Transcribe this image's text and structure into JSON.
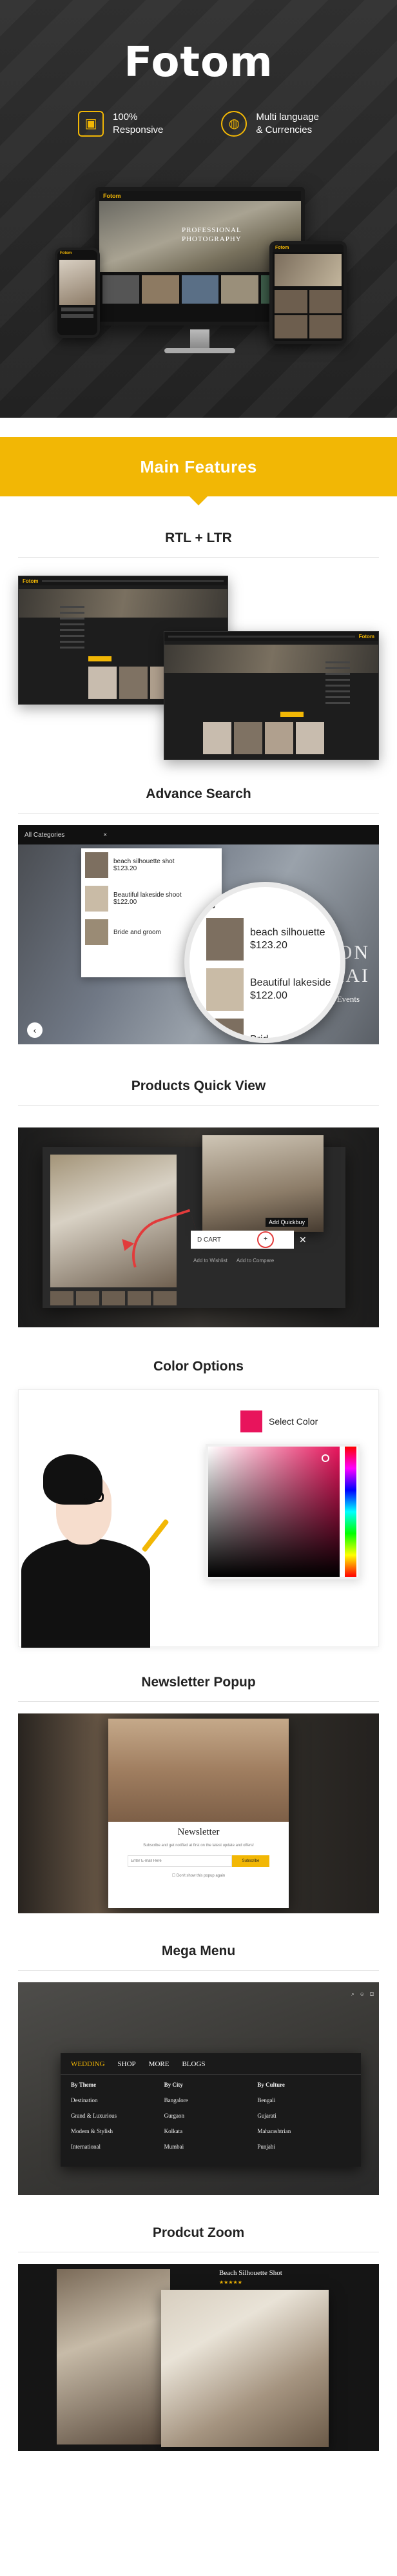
{
  "hero": {
    "logo": "Fotom",
    "features": [
      {
        "icon": "responsive-icon",
        "line1": "100%",
        "line2": "Responsive"
      },
      {
        "icon": "globe-icon",
        "line1": "Multi language",
        "line2": "& Currencies"
      }
    ],
    "monitor_caption_line1": "PROFESSIONAL",
    "monitor_caption_line2": "PHOTOGRAPHY",
    "mini_logo": "Fotom"
  },
  "banner": {
    "title": "Main Features"
  },
  "sections": {
    "rtl": {
      "title": "RTL + LTR"
    },
    "search": {
      "title": "Advance Search",
      "category_label": "All Categories",
      "dropdown_items": [
        {
          "name": "beach silhouette shot",
          "price": "$123.20"
        },
        {
          "name": "Beautiful lakeside shoot",
          "price": "$122.00"
        },
        {
          "name": "Bride and groom",
          "price": ""
        }
      ],
      "magnified_query": "B",
      "magnified_items": [
        {
          "name": "beach silhouette",
          "price": "$123.20"
        },
        {
          "name": "Beautiful lakeside",
          "price": "$122.00"
        },
        {
          "name": "Brid",
          "price": ""
        }
      ],
      "hero_text_line1": "ESSION",
      "hero_text_line2": "OGRAI",
      "hero_sub": "ashion & Events"
    },
    "quickview": {
      "title": "Products Quick View",
      "cart_label": "D CART",
      "tooltip": "Add Quickbuy",
      "wishlist": "Add to Wishlist",
      "compare": "Add to Compare"
    },
    "color": {
      "title": "Color Options",
      "select_label": "Select Color",
      "swatch": "#e8145c"
    },
    "newsletter": {
      "title": "Newsletter Popup",
      "modal_title": "Newsletter",
      "modal_sub": "Subscribe and get notified at first on the latest update and offers!",
      "placeholder": "Enter E-mail Here",
      "button": "Subscribe",
      "checkbox": "Don't show this popup again"
    },
    "mega": {
      "title": "Mega Menu",
      "tabs": [
        "WEDDING",
        "SHOP",
        "MORE",
        "BLOGS"
      ],
      "columns": [
        {
          "head": "By Theme",
          "items": [
            "Destination",
            "Grand & Luxurious",
            "Modern & Stylish",
            "International"
          ]
        },
        {
          "head": "By City",
          "items": [
            "Bangalore",
            "Gurgaon",
            "Kolkata",
            "Mumbai"
          ]
        },
        {
          "head": "By Culture",
          "items": [
            "Bengali",
            "Gujarati",
            "Maharashtrian",
            "Punjabi"
          ]
        }
      ]
    },
    "zoom": {
      "title": "Prodcut Zoom",
      "product_title": "Beach Silhouette Shot",
      "stars": "★★★★★"
    }
  },
  "colors": {
    "accent": "#f2b705",
    "dark": "#2b2b2b",
    "red": "#e23b3b"
  }
}
